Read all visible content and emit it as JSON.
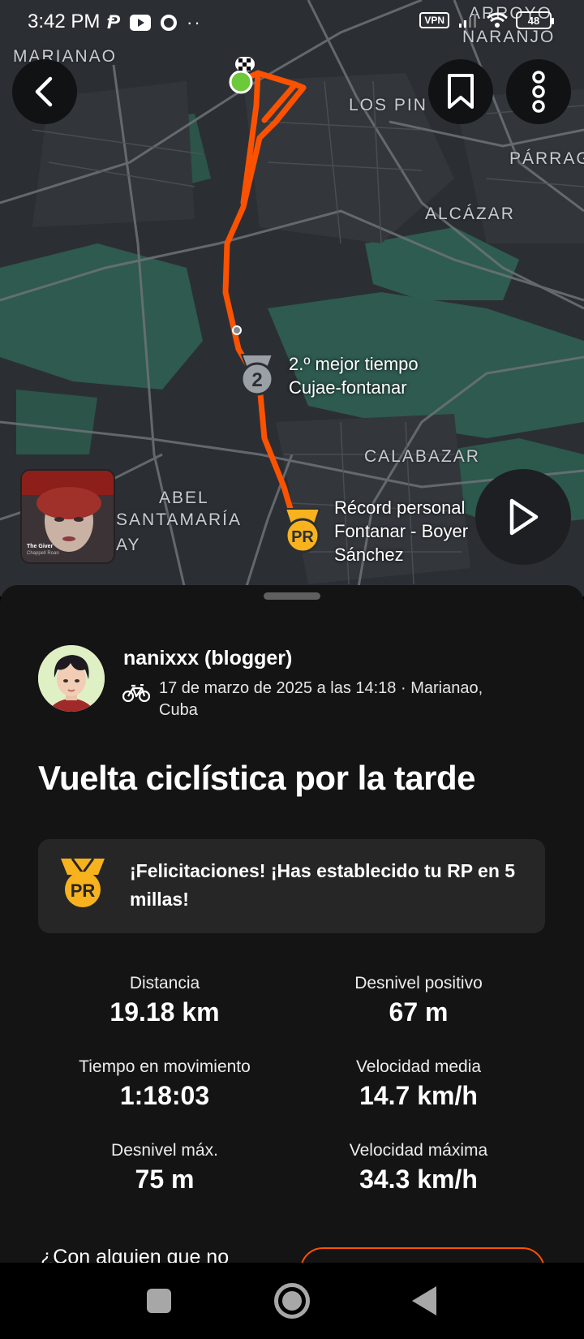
{
  "status_bar": {
    "time": "3:42 PM",
    "vpn": "VPN",
    "battery": "48"
  },
  "map": {
    "place_labels": [
      "MARIANAO",
      "ARROYO",
      "NARANJO",
      "LOS PIN",
      "PÁRRAG",
      "ALCÁZAR",
      "CALABAZAR",
      "ABEL",
      "SANTAMARÍA",
      "AY"
    ],
    "segment_2nd": {
      "badge": "2",
      "line1": "2.º mejor tiempo",
      "line2": "Cujae-fontanar"
    },
    "segment_pr": {
      "badge": "PR",
      "line1": "Récord personal",
      "line2": "Fontanar - Boyer",
      "line3": "Sánchez"
    },
    "route_color": "#fc5200",
    "music": {
      "title": "The Giver",
      "artist": "Chappell Roan"
    }
  },
  "activity": {
    "athlete": "nanixxx (blogger)",
    "meta": "17 de marzo de 2025 a las 14:18 · Marianao, Cuba",
    "title": "Vuelta ciclística por la tarde",
    "pr_message": "¡Felicitaciones! ¡Has establecido tu RP en 5 millas!",
    "pr_badge": "PR",
    "stats": [
      {
        "label": "Distancia",
        "value": "19.18 km"
      },
      {
        "label": "Desnivel positivo",
        "value": "67 m"
      },
      {
        "label": "Tiempo en movimiento",
        "value": "1:18:03"
      },
      {
        "label": "Velocidad media",
        "value": "14.7 km/h"
      },
      {
        "label": "Desnivel máx.",
        "value": "75 m"
      },
      {
        "label": "Velocidad máxima",
        "value": "34.3 km/h"
      }
    ],
    "peek_text": "¿Con alguien que no"
  }
}
